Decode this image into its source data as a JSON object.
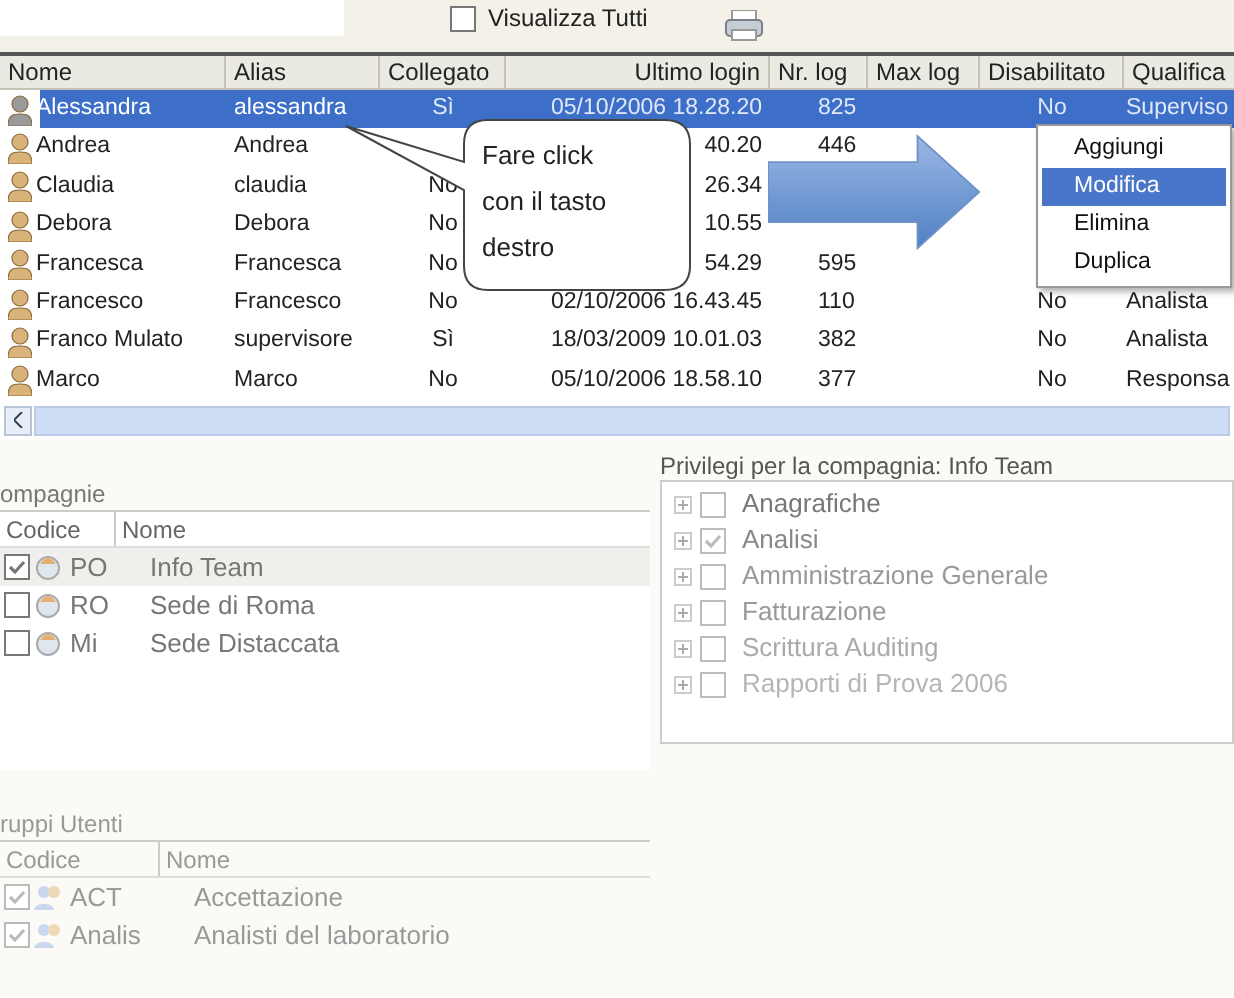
{
  "toolbar": {
    "show_all": {
      "label": "Visualizza Tutti",
      "checked": false
    }
  },
  "users": {
    "columns": [
      "Nome",
      "Alias",
      "Collegato",
      "Ultimo login",
      "Nr. log",
      "Max log",
      "Disabilitato",
      "Qualifica"
    ],
    "rows": [
      {
        "selected": true,
        "nome": "Alessandra",
        "alias": "alessandra",
        "collegato": "Sì",
        "login": "05/10/2006 18.28.20",
        "nr_log": "825",
        "disabilitato": "No",
        "qualifica": "Superviso"
      },
      {
        "selected": false,
        "nome": "Andrea",
        "alias": "Andrea",
        "login": "40.20",
        "nr_log": "446"
      },
      {
        "selected": false,
        "nome": "Claudia",
        "alias": "claudia",
        "collegato": "No",
        "login": "26.34"
      },
      {
        "selected": false,
        "nome": "Debora",
        "alias": "Debora",
        "collegato": "No",
        "login": "10.55"
      },
      {
        "selected": false,
        "nome": "Francesca",
        "alias": "Francesca",
        "collegato": "No",
        "login": "54.29",
        "nr_log": "595"
      },
      {
        "selected": false,
        "nome": "Francesco",
        "alias": "Francesco",
        "collegato": "No",
        "login": "02/10/2006 16.43.45",
        "nr_log": "110",
        "disabilitato": "No",
        "qualifica": "Analista"
      },
      {
        "selected": false,
        "nome": "Franco Mulato",
        "alias": "supervisore",
        "collegato": "Sì",
        "login": "18/03/2009 10.01.03",
        "nr_log": "382",
        "disabilitato": "No",
        "qualifica": "Analista"
      },
      {
        "selected": false,
        "nome": "Marco",
        "alias": "Marco",
        "collegato": "No",
        "login": "05/10/2006 18.58.10",
        "nr_log": "377",
        "disabilitato": "No",
        "qualifica": "Responsa"
      }
    ]
  },
  "callout": {
    "text": "Fare click con il tasto destro"
  },
  "context_menu": {
    "items": [
      {
        "label": "Aggiungi",
        "selected": false
      },
      {
        "label": "Modifica",
        "selected": true
      },
      {
        "label": "Elimina",
        "selected": false
      },
      {
        "label": "Duplica",
        "selected": false
      }
    ]
  },
  "companies": {
    "title": "ompagnie",
    "columns": [
      "Codice",
      "Nome"
    ],
    "rows": [
      {
        "checked": true,
        "selected": true,
        "code": "PO",
        "name": "Info Team"
      },
      {
        "checked": false,
        "selected": false,
        "code": "RO",
        "name": "Sede di Roma"
      },
      {
        "checked": false,
        "selected": false,
        "code": "Mi",
        "name": "Sede Distaccata"
      }
    ]
  },
  "privileges": {
    "title": "Privilegi per la compagnia: Info Team",
    "items": [
      {
        "label": "Anagrafiche",
        "checked": false
      },
      {
        "label": "Analisi",
        "checked": true
      },
      {
        "label": "Amministrazione Generale",
        "checked": false
      },
      {
        "label": "Fatturazione",
        "checked": false
      },
      {
        "label": "Scrittura Auditing",
        "checked": false
      },
      {
        "label": "Rapporti di Prova 2006",
        "checked": false
      }
    ]
  },
  "groups": {
    "title": "ruppi Utenti",
    "columns": [
      "Codice",
      "Nome"
    ],
    "rows": [
      {
        "checked": true,
        "code": "ACT",
        "name": "Accettazione"
      },
      {
        "checked": true,
        "code": "Analis",
        "name": "Analisti del laboratorio"
      }
    ]
  }
}
